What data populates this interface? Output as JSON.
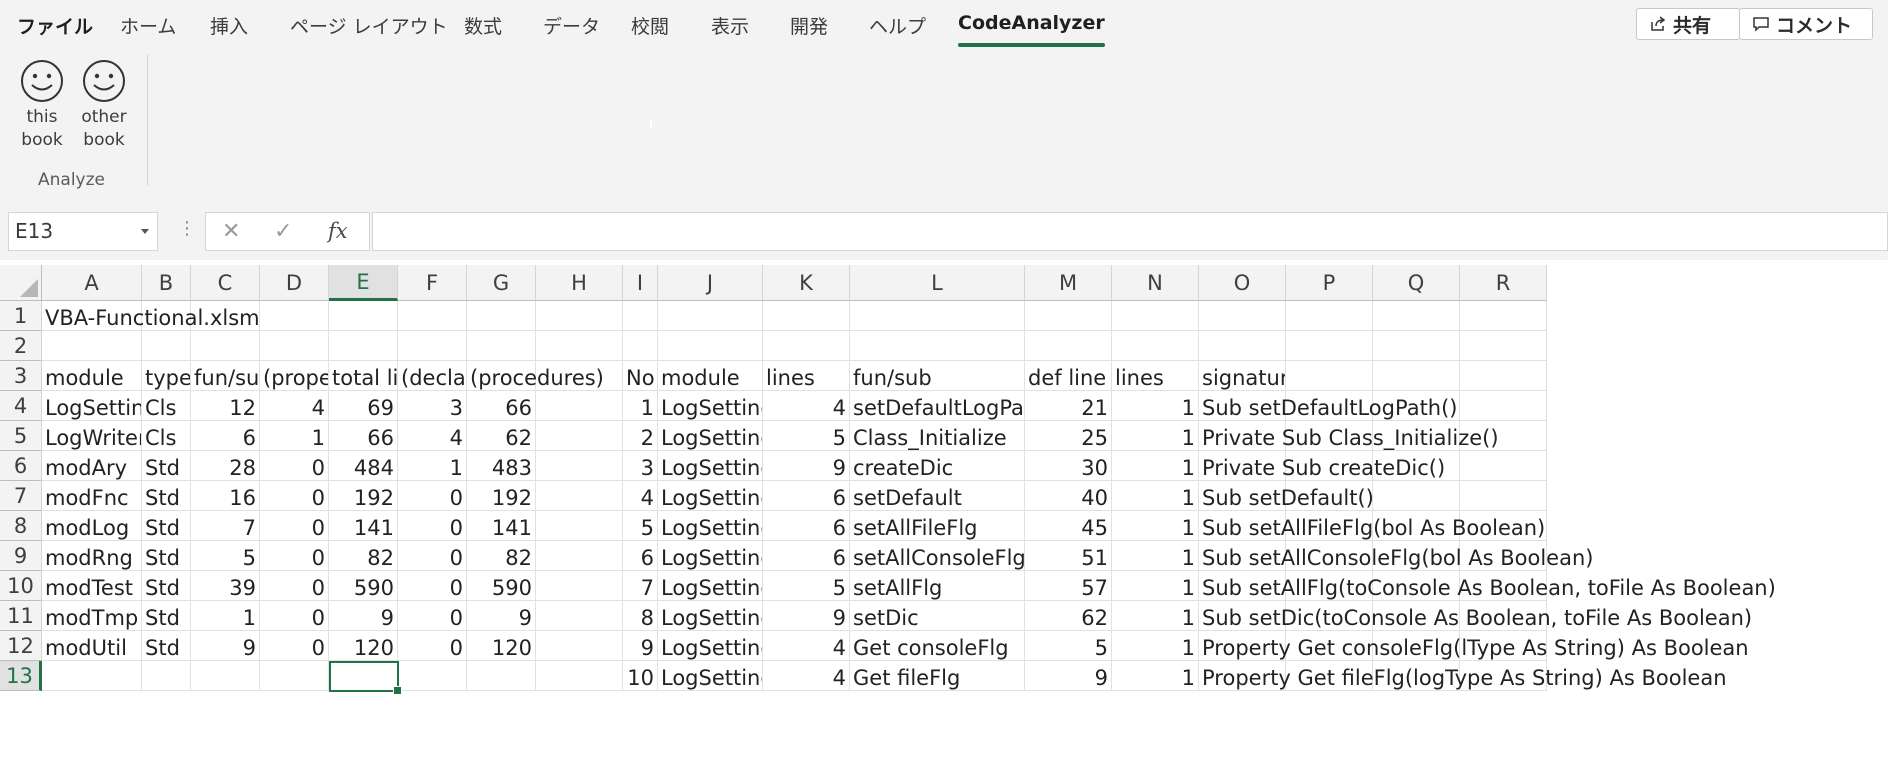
{
  "ribbon": {
    "tabs": [
      "ファイル",
      "ホーム",
      "挿入",
      "ページ レイアウト",
      "数式",
      "データ",
      "校閲",
      "表示",
      "開発",
      "ヘルプ",
      "CodeAnalyzer"
    ],
    "active_tab": "CodeAnalyzer",
    "share_label": "共有",
    "comment_label": "コメント",
    "buttons": [
      {
        "line1": "this",
        "line2": "book",
        "icon": "smiley-icon"
      },
      {
        "line1": "other",
        "line2": "book",
        "icon": "smiley-icon"
      }
    ],
    "group_label": "Analyze"
  },
  "formula_bar": {
    "name_box": "E13",
    "fx_label": "fx",
    "formula": ""
  },
  "grid": {
    "columns": [
      "A",
      "B",
      "C",
      "D",
      "E",
      "F",
      "G",
      "H",
      "I",
      "J",
      "K",
      "L",
      "M",
      "N",
      "O",
      "P",
      "Q",
      "R"
    ],
    "rows": [
      "1",
      "2",
      "3",
      "4",
      "5",
      "6",
      "7",
      "8",
      "9",
      "10",
      "11",
      "12",
      "13"
    ],
    "selected_cell": "E13",
    "r1_a": "VBA-Functional.xlsm",
    "summary_headers": [
      "module",
      "type",
      "fun/sub",
      "(property)",
      "total lines",
      "(declarations)",
      "(procedures)"
    ],
    "summary_rows": [
      [
        "LogSetting",
        "Cls",
        "12",
        "4",
        "69",
        "3",
        "66"
      ],
      [
        "LogWriter",
        "Cls",
        "6",
        "1",
        "66",
        "4",
        "62"
      ],
      [
        "modAry",
        "Std",
        "28",
        "0",
        "484",
        "1",
        "483"
      ],
      [
        "modFnc",
        "Std",
        "16",
        "0",
        "192",
        "0",
        "192"
      ],
      [
        "modLog",
        "Std",
        "7",
        "0",
        "141",
        "0",
        "141"
      ],
      [
        "modRng",
        "Std",
        "5",
        "0",
        "82",
        "0",
        "82"
      ],
      [
        "modTest",
        "Std",
        "39",
        "0",
        "590",
        "0",
        "590"
      ],
      [
        "modTmp",
        "Std",
        "1",
        "0",
        "9",
        "0",
        "9"
      ],
      [
        "modUtil",
        "Std",
        "9",
        "0",
        "120",
        "0",
        "120"
      ]
    ],
    "detail_headers": [
      "No",
      "module",
      "lines",
      "fun/sub",
      "def line",
      "lines",
      "signature"
    ],
    "detail_rows": [
      [
        "1",
        "LogSetting",
        "4",
        "setDefaultLogPath",
        "21",
        "1",
        "Sub setDefaultLogPath()"
      ],
      [
        "2",
        "LogSetting",
        "5",
        "Class_Initialize",
        "25",
        "1",
        "Private Sub Class_Initialize()"
      ],
      [
        "3",
        "LogSetting",
        "9",
        "createDic",
        "30",
        "1",
        "Private Sub createDic()"
      ],
      [
        "4",
        "LogSetting",
        "6",
        "setDefault",
        "40",
        "1",
        "Sub setDefault()"
      ],
      [
        "5",
        "LogSetting",
        "6",
        "setAllFileFlg",
        "45",
        "1",
        "Sub setAllFileFlg(bol As Boolean)"
      ],
      [
        "6",
        "LogSetting",
        "6",
        "setAllConsoleFlg",
        "51",
        "1",
        "Sub setAllConsoleFlg(bol As Boolean)"
      ],
      [
        "7",
        "LogSetting",
        "5",
        "setAllFlg",
        "57",
        "1",
        "Sub setAllFlg(toConsole As Boolean, toFile As Boolean)"
      ],
      [
        "8",
        "LogSetting",
        "9",
        "setDic",
        "62",
        "1",
        "Sub setDic(toConsole As Boolean, toFile As Boolean)"
      ],
      [
        "9",
        "LogSetting",
        "4",
        "Get consoleFlg",
        "5",
        "1",
        "Property Get consoleFlg(lType As String) As Boolean"
      ],
      [
        "10",
        "LogSetting",
        "4",
        "Get fileFlg",
        "9",
        "1",
        "Property Get fileFlg(logType As String) As Boolean"
      ]
    ]
  }
}
